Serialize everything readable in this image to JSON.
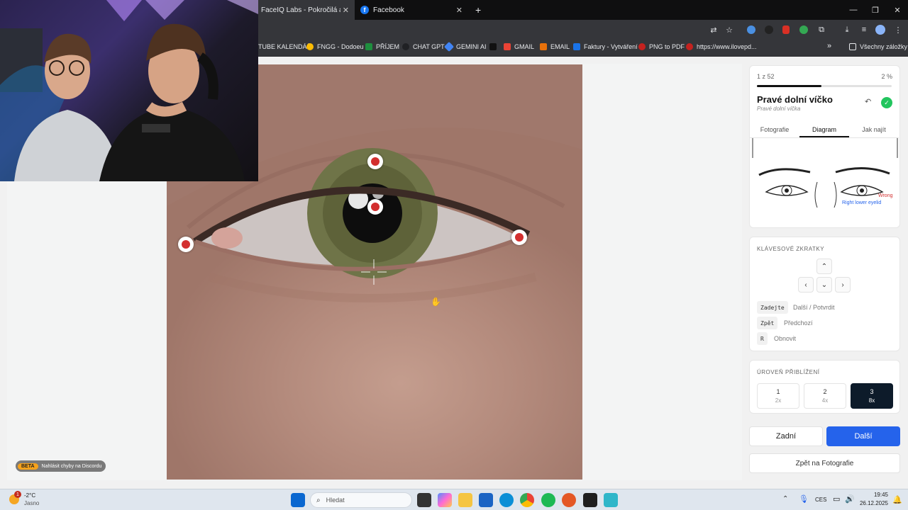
{
  "browser": {
    "tabs": [
      {
        "title": "FaceIQ Labs - Pokročilá analýza",
        "active": true
      },
      {
        "title": "Facebook",
        "active": false
      }
    ],
    "new_tab": "+",
    "window_controls": {
      "minimize": "—",
      "restore": "❐",
      "close": "✕"
    },
    "bookmarks": [
      {
        "label": "TUBE KALENDÁŘ",
        "color": "#d93025"
      },
      {
        "label": "FNGG - Dodoeu",
        "color": "#fbbc04"
      },
      {
        "label": "PŘÍJEM",
        "color": "#1e8e3e"
      },
      {
        "label": "CHAT GPT",
        "color": "#202124"
      },
      {
        "label": "GEMINI AI",
        "color": "#4285f4"
      },
      {
        "label": "",
        "color": "#111111"
      },
      {
        "label": "GMAIL",
        "color": "#ea4335"
      },
      {
        "label": "EMAIL",
        "color": "#e8710a"
      },
      {
        "label": "Faktury - Vytváření",
        "color": "#1a73e8"
      },
      {
        "label": "PNG to PDF",
        "color": "#c5221f"
      },
      {
        "label": "https://www.ilovepd...",
        "color": "#c5221f"
      }
    ],
    "bookmarks_more": "»",
    "all_bookmarks": "Všechny záložky"
  },
  "page": {
    "beta_tag": "BETA",
    "beta_text": "Nahlásit chyby na Discordu"
  },
  "panel": {
    "counter": "1 z 52",
    "percent": "2 %",
    "progress": 0.48,
    "title": "Pravé dolní víčko",
    "subtitle": "Pravé dolní víčka",
    "tabs": [
      "Fotografie",
      "Diagram",
      "Jak najít"
    ],
    "active_tab": "Diagram",
    "diagram_labels": {
      "wrong": "Wrong",
      "right": "Right lower eyelid"
    },
    "shortcuts_title": "KLÁVESOVÉ ZKRATKY",
    "arrows": {
      "up": "⌃",
      "left": "‹",
      "down": "⌄",
      "right": "›"
    },
    "keys": [
      {
        "key": "Zadejte",
        "desc": "Další / Potvrdit"
      },
      {
        "key": "Zpět",
        "desc": "Předchozí"
      },
      {
        "key": "R",
        "desc": "Obnovit"
      }
    ],
    "zoom_title": "ÚROVEŇ PŘIBLÍŽENÍ",
    "zoom_levels": [
      {
        "n": "1",
        "x": "2x"
      },
      {
        "n": "2",
        "x": "4x"
      },
      {
        "n": "3",
        "x": "8x"
      }
    ],
    "btn_back": "Zadní",
    "btn_next": "Další",
    "btn_photos": "Zpět na Fotografie",
    "colors": {
      "accent": "#2563eb",
      "ok": "#22c55e",
      "marker": "#d32f2f"
    }
  },
  "taskbar": {
    "temp": "-2°C",
    "weather": "Jasno",
    "notif": "1",
    "search": "Hledat",
    "lang": "CES",
    "time": "19:45",
    "date": "26.12.2025"
  }
}
